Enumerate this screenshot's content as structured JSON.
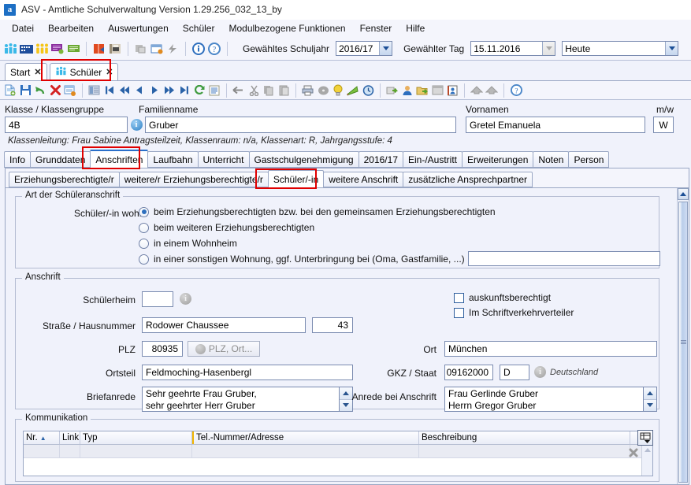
{
  "window": {
    "title": "ASV - Amtliche Schulverwaltung Version 1.29.256_032_13_by",
    "app_icon_letter": "a"
  },
  "menubar": {
    "items": [
      "Datei",
      "Bearbeiten",
      "Auswertungen",
      "Schüler",
      "Modulbezogene Funktionen",
      "Fenster",
      "Hilfe"
    ]
  },
  "toolbar_top": {
    "schuljahr_label": "Gewähltes Schuljahr",
    "schuljahr_value": "2016/17",
    "tag_label": "Gewählter Tag",
    "tag_value": "15.11.2016",
    "heute_value": "Heute",
    "icons": [
      "students-group-icon",
      "school-building-icon",
      "teachers-icon",
      "message-settings-icon",
      "message-icon",
      "report-book-icon",
      "print-report-icon",
      "modules-icon",
      "window-close-icon",
      "lightning-icon",
      "info-icon",
      "help-icon"
    ]
  },
  "doc_tabs": [
    {
      "label": "Start",
      "selected": false,
      "icon": "",
      "close": "✕"
    },
    {
      "label": "Schüler",
      "selected": true,
      "icon": "students-group-icon",
      "close": "✕"
    }
  ],
  "record_toolbar": {
    "icons": [
      "new-record-icon",
      "save-icon",
      "undo-icon",
      "delete-icon",
      "edit-list-icon",
      "table-view-icon",
      "first-record-icon",
      "fast-back-icon",
      "prev-record-icon",
      "next-record-icon",
      "fast-forward-icon",
      "last-record-icon",
      "refresh-icon",
      "list-icon",
      "back-arrow-icon",
      "cut-icon",
      "copy-icon",
      "paste-icon",
      "print-icon",
      "cd-icon",
      "bulb-icon",
      "flag-icon",
      "clock-icon",
      "export-icon",
      "person-icon",
      "folder-export-icon",
      "window-icon",
      "contact-card-icon",
      "up-arrow-icon",
      "up-arrow2-icon",
      "help-circle-icon"
    ]
  },
  "header": {
    "klasse_label": "Klasse / Klassengruppe",
    "klasse_value": "4B",
    "familienname_label": "Familienname",
    "familienname_value": "Gruber",
    "vornamen_label": "Vornamen",
    "vornamen_value": "Gretel Emanuela",
    "mw_label": "m/w",
    "mw_value": "W",
    "note": "Klassenleitung: Frau Sabine Antragsteilzeit, Klassenraum: n/a, Klassenart: R, Jahrgangsstufe: 4"
  },
  "main_tabs": [
    {
      "label": "Info",
      "selected": false
    },
    {
      "label": "Grunddaten",
      "selected": false
    },
    {
      "label": "Anschriften",
      "selected": true
    },
    {
      "label": "Laufbahn",
      "selected": false
    },
    {
      "label": "Unterricht",
      "selected": false
    },
    {
      "label": "Gastschulgenehmigung",
      "selected": false
    },
    {
      "label": "2016/17",
      "selected": false
    },
    {
      "label": "Ein-/Austritt",
      "selected": false
    },
    {
      "label": "Erweiterungen",
      "selected": false
    },
    {
      "label": "Noten",
      "selected": false
    },
    {
      "label": "Person",
      "selected": false
    }
  ],
  "sub_tabs": [
    {
      "label": "Erziehungsberechtigte/r",
      "selected": false
    },
    {
      "label": "weitere/r Erziehungsberechtigte/r",
      "selected": false
    },
    {
      "label": "Schüler/-in",
      "selected": true
    },
    {
      "label": "weitere Anschrift",
      "selected": false
    },
    {
      "label": "zusätzliche Ansprechpartner",
      "selected": false
    }
  ],
  "group_art": {
    "title": "Art der Schüleranschrift",
    "label": "Schüler/-in wohnt",
    "options": [
      {
        "label": "beim Erziehungsberechtigten bzw. bei den gemeinsamen Erziehungsberechtigten",
        "checked": true
      },
      {
        "label": "beim weiteren Erziehungsberechtigten",
        "checked": false
      },
      {
        "label": "in einem Wohnheim",
        "checked": false
      },
      {
        "label": "in einer sonstigen Wohnung, ggf. Unterbringung bei (Oma, Gastfamilie, ...)",
        "checked": false
      }
    ],
    "other_value": ""
  },
  "group_anschrift": {
    "title": "Anschrift",
    "schuelerheim_label": "Schülerheim",
    "schuelerheim_value": "",
    "strasse_label": "Straße / Hausnummer",
    "strasse_value": "Rodower Chaussee",
    "hausnummer_value": "43",
    "plz_label": "PLZ",
    "plz_value": "80935",
    "plz_button": "PLZ, Ort...",
    "ortsteil_label": "Ortsteil",
    "ortsteil_value": "Feldmoching-Hasenbergl",
    "briefanrede_label": "Briefanrede",
    "briefanrede_line1": "Sehr geehrte Frau Gruber,",
    "briefanrede_line2": "sehr geehrter Herr Gruber",
    "auskunftsberechtigt_label": "auskunftsberechtigt",
    "auskunftsberechtigt_checked": false,
    "schriftverkehr_label": "Im Schriftverkehrverteiler",
    "schriftverkehr_checked": false,
    "ort_label": "Ort",
    "ort_value": "München",
    "gkz_label": "GKZ / Staat",
    "gkz_value": "09162000",
    "staat_value": "D",
    "staat_text": "Deutschland",
    "anrede_label": "Anrede bei Anschrift",
    "anrede_line1": "Frau Gerlinde Gruber",
    "anrede_line2": "Herrn Gregor Gruber"
  },
  "group_kommunikation": {
    "title": "Kommunikation",
    "columns": [
      "Nr.",
      "Link",
      "Typ",
      "Tel.-Nummer/Adresse",
      "Beschreibung"
    ],
    "sort_indicator": "▲",
    "rows": [
      {
        "nr": "",
        "link": "",
        "typ": "",
        "tel": "",
        "beschreibung": ""
      }
    ],
    "column_chooser_icon": "column-chooser-icon",
    "delete_row_icon": "delete-row-icon"
  },
  "highlights": {
    "color": "#e00000"
  }
}
